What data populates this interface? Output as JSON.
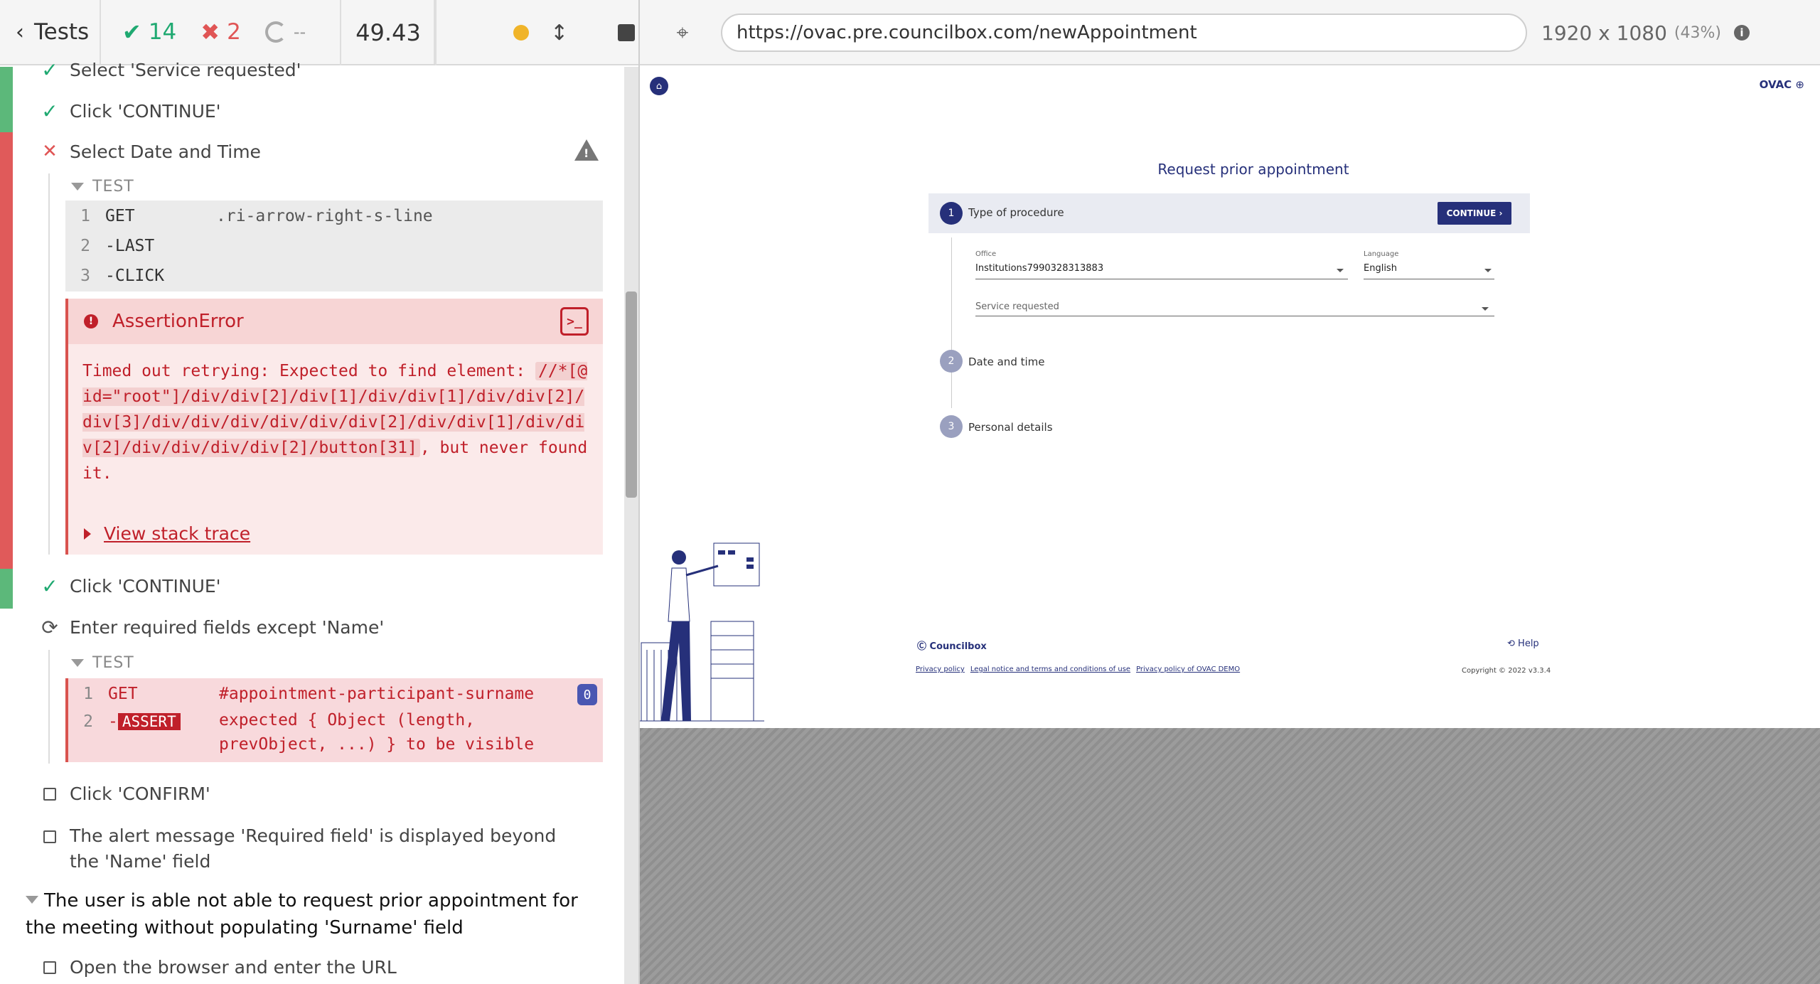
{
  "reporter": {
    "back_label": "Tests",
    "passed": "14",
    "failed": "2",
    "pending": "--",
    "duration": "49.43",
    "commands": [
      {
        "label": "Select 'Service requested'",
        "state": "passed"
      },
      {
        "label": "Click 'CONTINUE'",
        "state": "passed"
      },
      {
        "label": "Select Date and Time",
        "state": "failed"
      },
      {
        "label": "Click 'CONTINUE'",
        "state": "passed"
      },
      {
        "label": "Enter required fields except 'Name'",
        "state": "running"
      },
      {
        "label": "Click 'CONFIRM'",
        "state": "pending"
      },
      {
        "label": "The alert message 'Required field' is displayed beyond the 'Name' field",
        "state": "pending"
      },
      {
        "label": "Open the browser and enter the URL",
        "state": "pending"
      }
    ],
    "test_label": "TEST",
    "log1": [
      {
        "num": "1",
        "key": "GET",
        "val": ".ri-arrow-right-s-line"
      },
      {
        "num": "2",
        "key": "-LAST",
        "val": ""
      },
      {
        "num": "3",
        "key": "-CLICK",
        "val": ""
      }
    ],
    "error": {
      "title": "AssertionError",
      "message_prefix": "Timed out retrying: Expected to find element: ",
      "selector": "//*[@id=\"root\"]/div/div[2]/div[1]/div/div[1]/div/div[2]/div[3]/div/div/div/div/div/div[2]/div/div[1]/div/div[2]/div/div/div/div[2]/button[31]",
      "message_suffix": ", but never found it.",
      "stack_label": "View stack trace"
    },
    "log2": [
      {
        "num": "1",
        "key": "GET",
        "val": "#appointment-participant-surname",
        "badge": "0"
      },
      {
        "num": "2",
        "key": "-",
        "tag": "ASSERT",
        "val": "expected { Object (length, prevObject, ...) } to be visible"
      }
    ],
    "suite_title": "The user is able not able to request prior appointment for the meeting without populating 'Surname' field"
  },
  "aut": {
    "url": "https://ovac.pre.councilbox.com/newAppointment",
    "viewport": "1920 x 1080",
    "scale": "(43%)",
    "brand": "OVAC",
    "title": "Request prior appointment",
    "steps": [
      {
        "num": "1",
        "label": "Type of procedure"
      },
      {
        "num": "2",
        "label": "Date and time"
      },
      {
        "num": "3",
        "label": "Personal details"
      }
    ],
    "continue_label": "CONTINUE ›",
    "office_label": "Office",
    "office_value": "Institutions7990328313883",
    "language_label": "Language",
    "language_value": "English",
    "service_placeholder": "Service requested",
    "footer_logo": "Councilbox",
    "help_label": "Help",
    "links": [
      "Privacy policy",
      "Legal notice and terms and conditions of use",
      "Privacy policy of OVAC DEMO"
    ],
    "copyright": "Copyright © 2022 v3.3.4"
  },
  "colors": {
    "pass": "#1fa971",
    "fail": "#c0202a",
    "brand": "#26307a"
  }
}
